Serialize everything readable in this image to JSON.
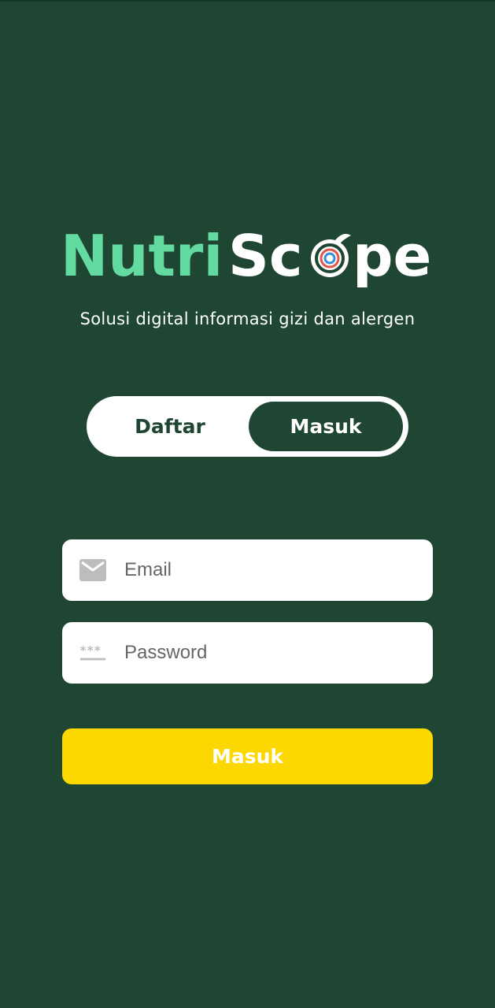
{
  "logo": {
    "part1": "Nutri",
    "part2": "Sc",
    "part3": "pe",
    "color_part1": "#63dba0",
    "color_part2": "#ffffff"
  },
  "tagline": "Solusi digital informasi gizi dan alergen",
  "toggle": {
    "tabs": [
      {
        "label": "Daftar",
        "active": false
      },
      {
        "label": "Masuk",
        "active": true
      }
    ]
  },
  "form": {
    "email": {
      "placeholder": "Email",
      "value": "",
      "icon": "mail-icon"
    },
    "password": {
      "placeholder": "Password",
      "value": "",
      "icon": "password-dots-icon"
    },
    "submit_label": "Masuk"
  },
  "colors": {
    "background": "#1f4633",
    "accent_yellow": "#fdd700",
    "logo_green": "#63dba0"
  }
}
